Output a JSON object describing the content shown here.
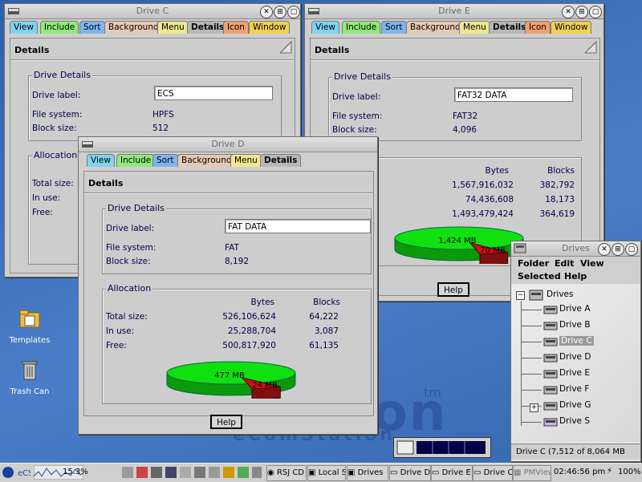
{
  "desktop": {
    "brand": "ion",
    "tm": "tm",
    "sub": "eComStation",
    "icons": [
      {
        "label": "Templates"
      },
      {
        "label": "Trash Can"
      }
    ]
  },
  "colors": {
    "used": "#d01010",
    "free": "#10e010",
    "label_fg": "#00004a",
    "tab_view": "#7fd4f0",
    "tab_include": "#90ea7a",
    "tab_sort": "#7fb4f0",
    "tab_background": "#e8c8b4",
    "tab_menu": "#f0e890",
    "tab_details": "#b8b8b8",
    "tab_icon": "#f0a070",
    "tab_window": "#f0d050"
  },
  "tabs": [
    "View",
    "Include",
    "Sort",
    "Background",
    "Menu",
    "Details",
    "Icon",
    "Window"
  ],
  "common": {
    "panel_title": "Details",
    "group_drive": "Drive Details",
    "group_alloc": "Allocation",
    "drive_label": "Drive label:",
    "file_system": "File system:",
    "block_size": "Block size:",
    "col_bytes": "Bytes",
    "col_blocks": "Blocks",
    "total": "Total size:",
    "inuse": "In use:",
    "free": "Free:",
    "help": "Help"
  },
  "driveC": {
    "title": "Drive C",
    "label_value": "ECS",
    "fs": "HPFS",
    "block": "512"
  },
  "driveE": {
    "title": "Drive E",
    "label_value": "FAT32 DATA",
    "fs": "FAT32",
    "block": "4,096",
    "total_bytes": "1,567,916,032",
    "total_blocks": "382,792",
    "inuse_bytes": "74,436,608",
    "inuse_blocks": "18,173",
    "free_bytes": "1,493,479,424",
    "free_blocks": "364,619",
    "pie_free": "1,424 MB",
    "pie_used": "70 MB",
    "used_fraction": 0.047
  },
  "driveD": {
    "title": "Drive D",
    "label_value": "FAT DATA",
    "fs": "FAT",
    "block": "8,192",
    "total_bytes": "526,106,624",
    "total_blocks": "64,222",
    "inuse_bytes": "25,288,704",
    "inuse_blocks": "3,087",
    "free_bytes": "500,817,920",
    "free_blocks": "61,135",
    "pie_free": "477 MB",
    "pie_used": "24 MB",
    "used_fraction": 0.048
  },
  "drives": {
    "title": "Drives",
    "menu": [
      "Folder",
      "Edit",
      "View",
      "Selected",
      "Help"
    ],
    "root": "Drives",
    "items": [
      "Drive A",
      "Drive B",
      "Drive C",
      "Drive D",
      "Drive E",
      "Drive F",
      "Drive G",
      "Drive S"
    ],
    "selected": "Drive C",
    "status": "Drive C (7,512 of 8,064 MB free)"
  },
  "taskbar": {
    "cpu": "15.3%",
    "items": [
      "RSJ CD",
      "Local S",
      "Drives",
      "Drive D",
      "Drive E",
      "Drive C",
      "PMView"
    ],
    "time": "02:46:56 pm",
    "battery": "100%"
  }
}
